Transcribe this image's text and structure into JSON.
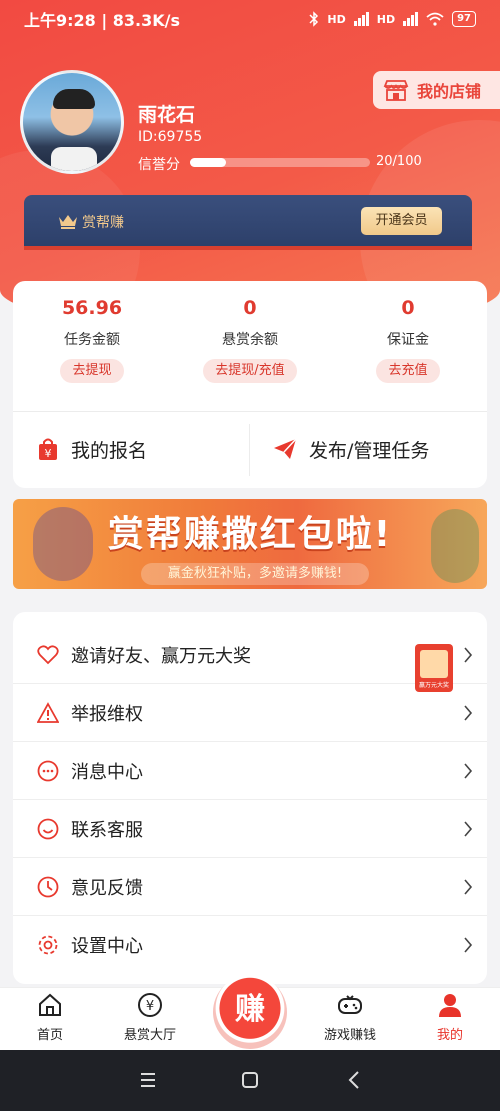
{
  "status_bar": {
    "time_speed": "上午9:28 | 83.3K/s",
    "battery": "97",
    "net_labels": [
      "HD",
      "HD"
    ]
  },
  "profile": {
    "name": "雨花石",
    "id": "ID:69755",
    "credit_label": "信誉分",
    "credit_value": "20/100",
    "credit_fraction": 0.2,
    "shop_button": "我的店铺"
  },
  "vip": {
    "title": "赏帮赚",
    "button": "开通会员"
  },
  "wallet": [
    {
      "value": "56.96",
      "label": "任务金额",
      "action": "去提现"
    },
    {
      "value": "0",
      "label": "悬赏余额",
      "action": "去提现/充值"
    },
    {
      "value": "0",
      "label": "保证金",
      "action": "去充值"
    }
  ],
  "actions": {
    "signup": "我的报名",
    "publish": "发布/管理任务"
  },
  "banner": {
    "title": "赏帮赚撒红包啦!",
    "subtitle": "赢金秋狂补贴，多邀请多赚钱!"
  },
  "menu": [
    {
      "label": "邀请好友、赢万元大奖",
      "icon": "heart-icon"
    },
    {
      "label": "举报维权",
      "icon": "warning-icon"
    },
    {
      "label": "消息中心",
      "icon": "message-icon"
    },
    {
      "label": "联系客服",
      "icon": "smile-icon"
    },
    {
      "label": "意见反馈",
      "icon": "clock-icon"
    },
    {
      "label": "设置中心",
      "icon": "gear-icon"
    }
  ],
  "gift_badge": "赢万元大奖",
  "tabbar": {
    "home": "首页",
    "bounty": "悬赏大厅",
    "earn": "赚",
    "games": "游戏赚钱",
    "mine": "我的"
  },
  "colors": {
    "primary": "#f24a42",
    "accent_text": "#e03b30",
    "vip_bg": "#2d406a",
    "vip_gold": "#f2c98c"
  }
}
